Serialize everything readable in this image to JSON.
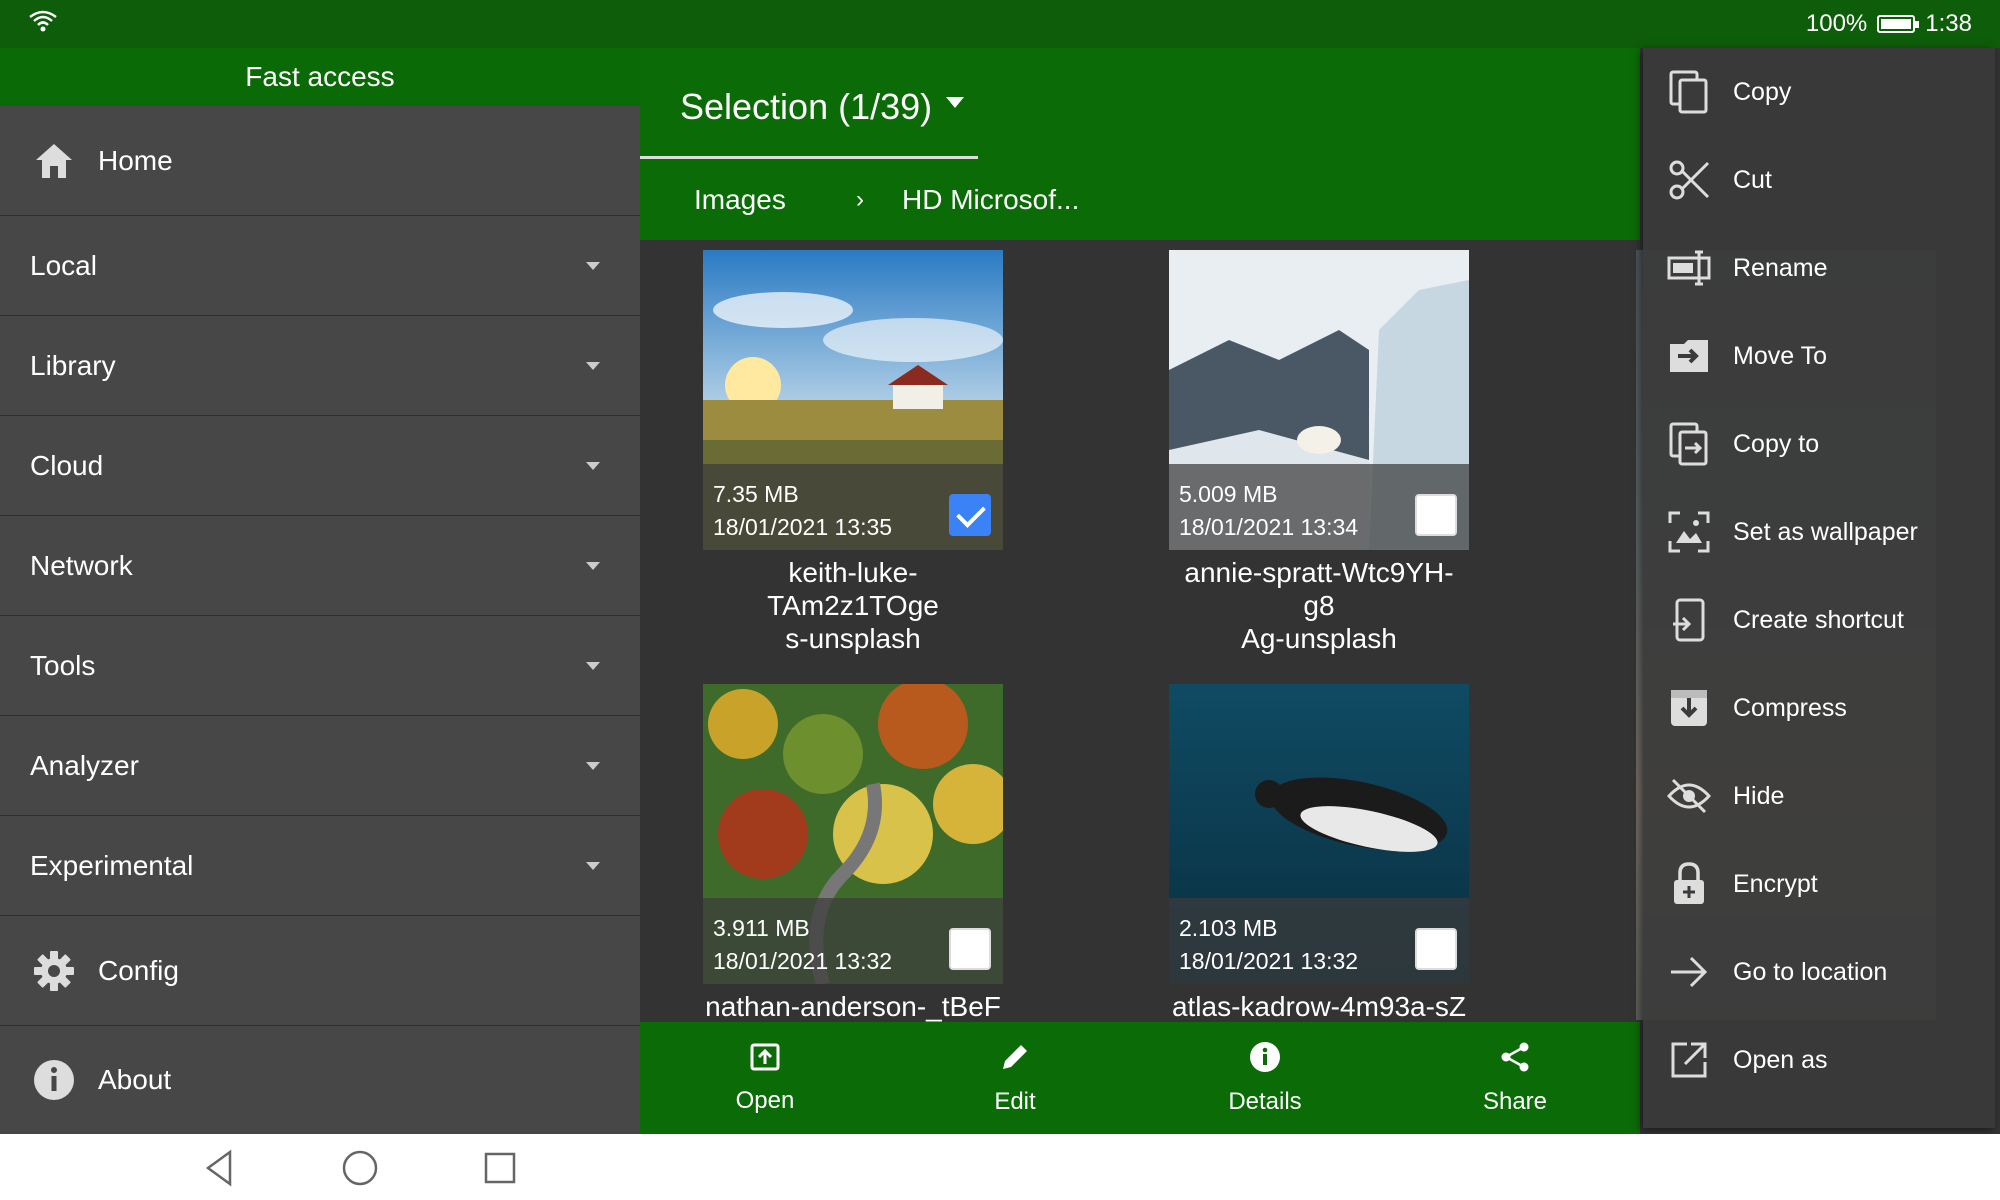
{
  "status": {
    "battery": "100%",
    "battery_level": 1.0,
    "time": "1:38"
  },
  "drawer": {
    "header": "Fast access",
    "items": [
      {
        "label": "Home",
        "icon": "home-icon"
      },
      {
        "label": "Local"
      },
      {
        "label": "Library"
      },
      {
        "label": "Cloud"
      },
      {
        "label": "Network"
      },
      {
        "label": "Tools"
      },
      {
        "label": "Analyzer"
      },
      {
        "label": "Experimental"
      },
      {
        "label": "Config",
        "icon": "gear-icon"
      },
      {
        "label": "About",
        "icon": "info-icon"
      }
    ]
  },
  "appbar": {
    "title": "Selection (1/39)"
  },
  "breadcrumb": {
    "root": "Images",
    "current": "HD Microsof..."
  },
  "files": [
    {
      "size": "7.35 MB",
      "date": "18/01/2021 13:35",
      "name_line1": "keith-luke-TAm2z1TOge",
      "name_line2": "s-unsplash",
      "checked": true
    },
    {
      "size": "5.009 MB",
      "date": "18/01/2021 13:34",
      "name_line1": "annie-spratt-Wtc9YH-g8",
      "name_line2": "Ag-unsplash",
      "checked": false
    },
    {
      "size": "3.911 MB",
      "date": "18/01/2021 13:32",
      "name_line1": "nathan-anderson-_tBeF",
      "name_line2": "",
      "checked": false
    },
    {
      "size": "2.103 MB",
      "date": "18/01/2021 13:32",
      "name_line1": "atlas-kadrow-4m93a-sZ",
      "name_line2": "",
      "checked": false
    }
  ],
  "bottombar": {
    "open": "Open",
    "edit": "Edit",
    "details": "Details",
    "share": "Share"
  },
  "menu": {
    "items": [
      {
        "label": "Copy",
        "icon": "copy-icon"
      },
      {
        "label": "Cut",
        "icon": "scissors-icon"
      },
      {
        "label": "Rename",
        "icon": "rename-icon"
      },
      {
        "label": "Move To",
        "icon": "move-to-icon"
      },
      {
        "label": "Copy to",
        "icon": "copy-to-icon"
      },
      {
        "label": "Set as wallpaper",
        "icon": "wallpaper-icon"
      },
      {
        "label": "Create shortcut",
        "icon": "shortcut-icon"
      },
      {
        "label": "Compress",
        "icon": "archive-icon"
      },
      {
        "label": "Hide",
        "icon": "eye-off-icon"
      },
      {
        "label": "Encrypt",
        "icon": "lock-icon"
      },
      {
        "label": "Go to location",
        "icon": "arrow-right-icon"
      },
      {
        "label": "Open as",
        "icon": "open-external-icon"
      }
    ]
  },
  "colors": {
    "green_dark": "#0e5d0a",
    "green": "#0b6b06",
    "drawer_bg": "#474747",
    "main_bg": "#333333",
    "check_blue": "#3b82f6"
  }
}
